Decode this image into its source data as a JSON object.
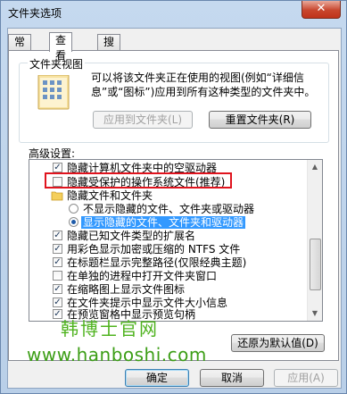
{
  "window": {
    "title": "文件夹选项",
    "close_glyph": "✕"
  },
  "tabs": [
    {
      "label": "常规",
      "active": false
    },
    {
      "label": "查看",
      "active": true
    },
    {
      "label": "搜索",
      "active": false
    }
  ],
  "folder_views": {
    "group_label": "文件夹视图",
    "description": "可以将该文件夹正在使用的视图(例如“详细信息”或“图标”)应用到所有这种类型的文件夹中。",
    "apply_button": "应用到文件夹(L)",
    "reset_button": "重置文件夹(R)"
  },
  "advanced": {
    "label": "高级设置:",
    "items": [
      {
        "type": "checkbox",
        "checked": true,
        "label": "隐藏计算机文件夹中的空驱动器"
      },
      {
        "type": "checkbox",
        "checked": false,
        "label": "隐藏受保护的操作系统文件(推荐)"
      },
      {
        "type": "folder",
        "label": "隐藏文件和文件夹"
      },
      {
        "type": "radio",
        "checked": false,
        "label": "不显示隐藏的文件、文件夹或驱动器"
      },
      {
        "type": "radio",
        "checked": true,
        "label": "显示隐藏的文件、文件夹和驱动器"
      },
      {
        "type": "checkbox",
        "checked": true,
        "label": "隐藏已知文件类型的扩展名"
      },
      {
        "type": "checkbox",
        "checked": true,
        "label": "用彩色显示加密或压缩的 NTFS 文件"
      },
      {
        "type": "checkbox",
        "checked": true,
        "label": "在标题栏显示完整路径(仅限经典主题)"
      },
      {
        "type": "checkbox",
        "checked": false,
        "label": "在单独的进程中打开文件夹窗口"
      },
      {
        "type": "checkbox",
        "checked": true,
        "label": "在缩略图上显示文件图标"
      },
      {
        "type": "checkbox",
        "checked": true,
        "label": "在文件夹提示中显示文件大小信息"
      },
      {
        "type": "checkbox",
        "checked": true,
        "label": "在预览窗格中显示预览句柄"
      }
    ],
    "restore_button": "还原为默认值(D)"
  },
  "watermark": {
    "line1": "韩博士官网",
    "line2": "www.hanboshi.com"
  },
  "footer": {
    "ok": "确定",
    "cancel": "取消",
    "apply": "应用(A)"
  },
  "colors": {
    "highlight_border": "#e0141e",
    "selection": "#3399ff",
    "watermark": "#4fb31f"
  }
}
